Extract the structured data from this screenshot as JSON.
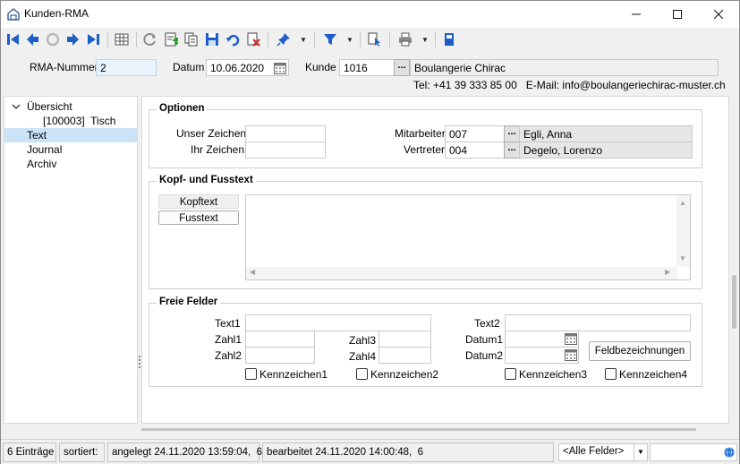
{
  "window": {
    "title": "Kunden-RMA"
  },
  "header": {
    "rma_label": "RMA-Nummer",
    "rma_value": "2",
    "datum_label": "Datum",
    "datum_value": "10.06.2020",
    "kunde_label": "Kunde",
    "kunde_value": "1016",
    "kunde_name": "Boulangerie Chirac",
    "contact_line": "Tel: +41 39 333 85 00   E-Mail: info@boulangeriechirac-muster.ch"
  },
  "tree": {
    "items": [
      {
        "label": "Übersicht"
      },
      {
        "label": "[100003]  Tisch"
      },
      {
        "label": "Text"
      },
      {
        "label": "Journal"
      },
      {
        "label": "Archiv"
      }
    ]
  },
  "optionen": {
    "title": "Optionen",
    "unser_zeichen_label": "Unser Zeichen",
    "unser_zeichen_value": "",
    "ihr_zeichen_label": "Ihr Zeichen",
    "ihr_zeichen_value": "",
    "mitarbeiter_label": "Mitarbeiter",
    "mitarbeiter_value": "007",
    "mitarbeiter_name": "Egli, Anna",
    "vertreter_label": "Vertreter",
    "vertreter_value": "004",
    "vertreter_name": "Degelo, Lorenzo"
  },
  "kopf": {
    "title": "Kopf- und Fusstext",
    "kopftext_label": "Kopftext",
    "fusstext_label": "Fusstext"
  },
  "freie": {
    "title": "Freie Felder",
    "text1_label": "Text1",
    "text2_label": "Text2",
    "zahl1_label": "Zahl1",
    "zahl2_label": "Zahl2",
    "zahl3_label": "Zahl3",
    "zahl4_label": "Zahl4",
    "datum1_label": "Datum1",
    "datum2_label": "Datum2",
    "feldbez_label": "Feldbezeichnungen",
    "k1_label": "Kennzeichen1",
    "k2_label": "Kennzeichen2",
    "k3_label": "Kennzeichen3",
    "k4_label": "Kennzeichen4"
  },
  "status": {
    "entries": "6 Einträge",
    "sorted": "sortiert:",
    "created": "angelegt 24.11.2020 13:59:04,  6",
    "edited": "bearbeitet 24.11.2020 14:00:48,  6",
    "filter": "<Alle Felder>"
  },
  "colors": {
    "nav_blue": "#1e5fc7",
    "selection": "#cce4f7",
    "field_blue": "#e8f3fc"
  }
}
